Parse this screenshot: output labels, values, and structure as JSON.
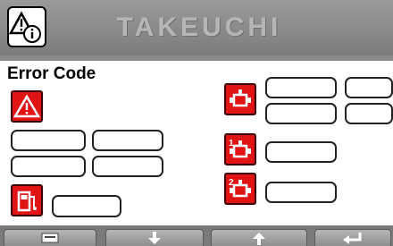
{
  "header": {
    "brand": "TAKEUCHI",
    "status_icon": "warning-info-icon"
  },
  "panel": {
    "title": "Error Code",
    "icons": {
      "warning": "warning-triangle-icon",
      "fuel": "fuel-pump-icon",
      "engine": "engine-icon",
      "motor_1": "motor-1-icon",
      "motor_2": "motor-2-icon"
    },
    "fields": {
      "warning_1": "",
      "warning_2": "",
      "warning_3": "",
      "warning_4": "",
      "fuel": "",
      "engine_1": "",
      "engine_2": "",
      "engine_3": "",
      "engine_4": "",
      "motor_1": "",
      "motor_2": ""
    }
  },
  "footer": {
    "keys": [
      {
        "icon": "menu-icon"
      },
      {
        "icon": "arrow-down-icon"
      },
      {
        "icon": "arrow-up-icon"
      },
      {
        "icon": "return-icon"
      }
    ]
  },
  "colors": {
    "accent_red": "#e01414",
    "header_gray": "#8a8a8a",
    "panel_bg": "#ffffff"
  }
}
